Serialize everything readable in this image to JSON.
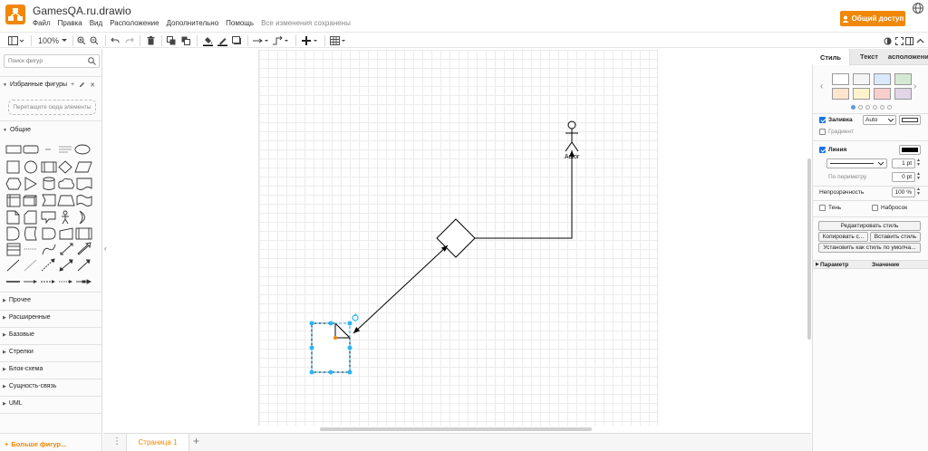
{
  "app": {
    "title": "GamesQA.ru.drawio",
    "menu": [
      "Файл",
      "Правка",
      "Вид",
      "Расположение",
      "Дополнительно",
      "Помощь"
    ],
    "saved_status": "Все изменения сохранены",
    "share_label": "Общий доступ"
  },
  "toolbar": {
    "zoom": "100%"
  },
  "left_panel": {
    "search_placeholder": "Поиск фигур",
    "favorites_title": "Избранные фигуры",
    "drop_hint": "Перетащите сюда элементы",
    "general_title": "Общие",
    "sections": [
      "Прочее",
      "Расширенные",
      "Базовые",
      "Стрелки",
      "Блок-схема",
      "Сущность-связь",
      "UML"
    ],
    "more_shapes": "Больше фигур..."
  },
  "canvas": {
    "actor_label": "Actor"
  },
  "pages": {
    "tabs": [
      "Страница 1"
    ]
  },
  "right_panel": {
    "tabs": [
      "Стиль",
      "Текст",
      "Расположение"
    ],
    "swatch_colors": [
      "#ffffff",
      "#f5f5f5",
      "#dae8fc",
      "#d5e8d4",
      "#ffe6cc",
      "#fff2cc",
      "#f8cecc",
      "#e1d5e7"
    ],
    "fill_label": "Заливка",
    "fill_mode": "Auto",
    "fill_color": "#ffffff",
    "gradient_label": "Градиент",
    "line_label": "Линия",
    "line_color": "#000000",
    "line_width": "1 pt",
    "perimeter_label": "По периметру",
    "perimeter_value": "0 pt",
    "opacity_label": "Непрозрачность",
    "opacity_value": "100 %",
    "shadow_label": "Тень",
    "sketch_label": "Набросок",
    "edit_style": "Редактировать стиль",
    "copy_style": "Копировать с...",
    "paste_style": "Вставить стиль",
    "set_default_style": "Установить как стиль по умолча...",
    "param_header": "Параметр",
    "value_header": "Значение"
  }
}
